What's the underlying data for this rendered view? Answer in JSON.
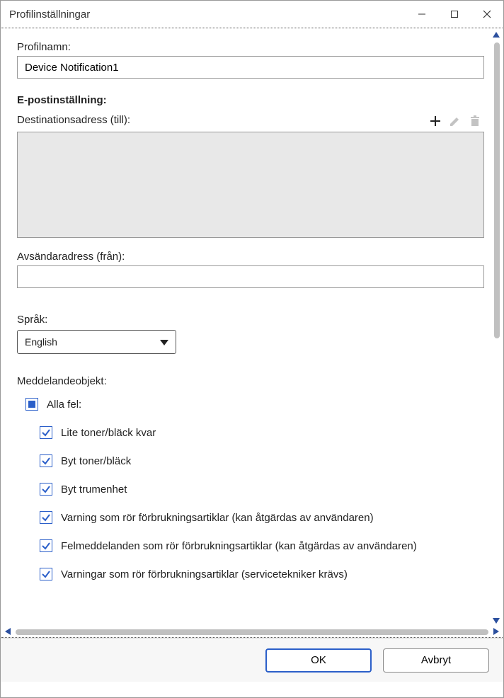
{
  "window": {
    "title": "Profilinställningar"
  },
  "profile": {
    "name_label": "Profilnamn:",
    "name_value": "Device Notification1"
  },
  "email": {
    "section_label": "E-postinställning:",
    "dest_label": "Destinationsadress (till):",
    "sender_label": "Avsändaradress (från):",
    "sender_value": ""
  },
  "language": {
    "label": "Språk:",
    "selected": "English"
  },
  "messages": {
    "label": "Meddelandeobjekt:",
    "root": "Alla fel:",
    "items": [
      "Lite toner/bläck kvar",
      "Byt toner/bläck",
      "Byt trumenhet",
      "Varning som rör förbrukningsartiklar (kan åtgärdas av användaren)",
      "Felmeddelanden som rör förbrukningsartiklar (kan åtgärdas av användaren)",
      "Varningar som rör förbrukningsartiklar (servicetekniker krävs)"
    ]
  },
  "buttons": {
    "ok": "OK",
    "cancel": "Avbryt"
  }
}
